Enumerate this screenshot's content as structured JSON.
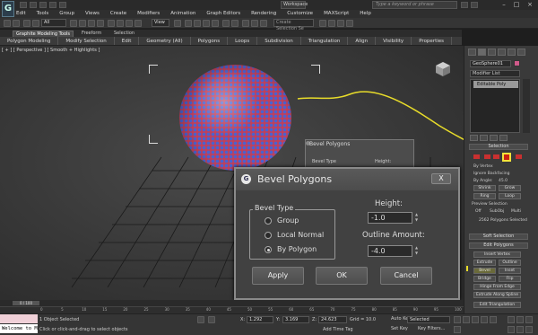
{
  "title_bar": {
    "workspace": "Workspace",
    "search_placeholder": "Type a keyword or phrase"
  },
  "menu": [
    "Edit",
    "Tools",
    "Group",
    "Views",
    "Create",
    "Modifiers",
    "Animation",
    "Graph Editors",
    "Rendering",
    "Customize",
    "MAXScript",
    "Help"
  ],
  "toolbar": {
    "selection_filter": "All",
    "reference_coord": "View",
    "named_selection_placeholder": "Create Selection Se"
  },
  "ribbon": {
    "tabs": [
      "Graphite Modeling Tools",
      "Freeform",
      "Selection"
    ],
    "panels": [
      "Polygon Modeling",
      "Modify Selection",
      "Edit",
      "Geometry (All)",
      "Polygons",
      "Loops",
      "Subdivision",
      "Triangulation",
      "Align",
      "Visibility",
      "Properties"
    ]
  },
  "viewport": {
    "label": "[ + ] [ Perspective ] [ Smooth + Highlights ]"
  },
  "bg_dialog": {
    "title": "Bevel Polygons",
    "type_label": "Bevel Type",
    "height_label": "Height:"
  },
  "dialog": {
    "title": "Bevel Polygons",
    "close": "X",
    "bevel_type_label": "Bevel Type",
    "options": [
      "Group",
      "Local Normal",
      "By Polygon"
    ],
    "selected_option": "By Polygon",
    "height_label": "Height:",
    "height_value": "-1.0",
    "outline_label": "Outline Amount:",
    "outline_value": "-4.0",
    "apply": "Apply",
    "ok": "OK",
    "cancel": "Cancel"
  },
  "command_panel": {
    "object_name": "GeoSphere01",
    "object_color": "#d05a8a",
    "modifier_list": "Modifier List",
    "stack_item": "Editable Poly",
    "selection_title": "Selection",
    "by_vertex": "By Vertex",
    "ignore_backfacing": "Ignore Backfacing",
    "by_angle": "By Angle:",
    "by_angle_value": "45.0",
    "shrink": "Shrink",
    "grow": "Grow",
    "ring": "Ring",
    "loop": "Loop",
    "preview_selection": "Preview Selection",
    "preview_off": "Off",
    "subobj": "SubObj",
    "multi": "Multi",
    "selected_count": "2562 Polygons Selected",
    "soft_selection": "Soft Selection",
    "edit_polygons": "Edit Polygons",
    "insert_vertex": "Insert Vertex",
    "extrude": "Extrude",
    "outline": "Outline",
    "bevel": "Bevel",
    "inset": "Inset",
    "bridge": "Bridge",
    "flip": "Flip",
    "hinge": "Hinge From Edge",
    "extrude_spline": "Extrude Along Spline",
    "edit_triangulation": "Edit Triangulation"
  },
  "timeline": {
    "frame": "0 / 100",
    "ticks": [
      "0",
      "5",
      "10",
      "15",
      "20",
      "25",
      "30",
      "35",
      "40",
      "45",
      "50",
      "55",
      "60",
      "65",
      "70",
      "75",
      "80",
      "85",
      "90",
      "95",
      "100"
    ]
  },
  "status": {
    "maxscript": "Welcome to M",
    "line1": "1 Object Selected",
    "line2": "Click or click-and-drag to select objects",
    "x_label": "X:",
    "x": "1.292",
    "y_label": "Y:",
    "y": "3.169",
    "z_label": "Z:",
    "z": "24.623",
    "grid": "Grid = 10.0",
    "add_time_tag": "Add Time Tag",
    "auto_key": "Auto Key",
    "set_key": "Set Key",
    "key_mode": "Selected",
    "key_filters": "Key Filters..."
  },
  "colors": {
    "sphere_red": "#c0405a",
    "sphere_blue": "#4a62d0",
    "highlight_yellow": "#f4e23a"
  }
}
